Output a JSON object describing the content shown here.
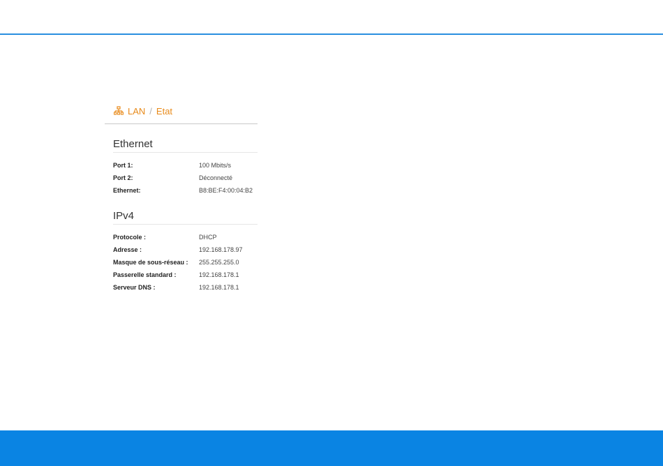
{
  "breadcrumb": {
    "icon": "network-icon",
    "items": [
      "LAN",
      "Etat"
    ],
    "separator": "/",
    "color": "#e88a1a"
  },
  "sections": [
    {
      "title": "Ethernet",
      "rows": [
        {
          "label": "Port 1:",
          "value": "100 Mbits/s"
        },
        {
          "label": "Port 2:",
          "value": "Déconnecté"
        },
        {
          "label": "Ethernet:",
          "value": "B8:BE:F4:00:04:B2"
        }
      ]
    },
    {
      "title": "IPv4",
      "rows": [
        {
          "label": "Protocole :",
          "value": "DHCP"
        },
        {
          "label": "Adresse :",
          "value": "192.168.178.97"
        },
        {
          "label": "Masque de sous-réseau :",
          "value": "255.255.255.0"
        },
        {
          "label": "Passerelle standard :",
          "value": "192.168.178.1"
        },
        {
          "label": "Serveur DNS :",
          "value": "192.168.178.1"
        }
      ]
    }
  ],
  "colors": {
    "header_rule": "#2a8fe0",
    "footer_band": "#0a84e3"
  }
}
